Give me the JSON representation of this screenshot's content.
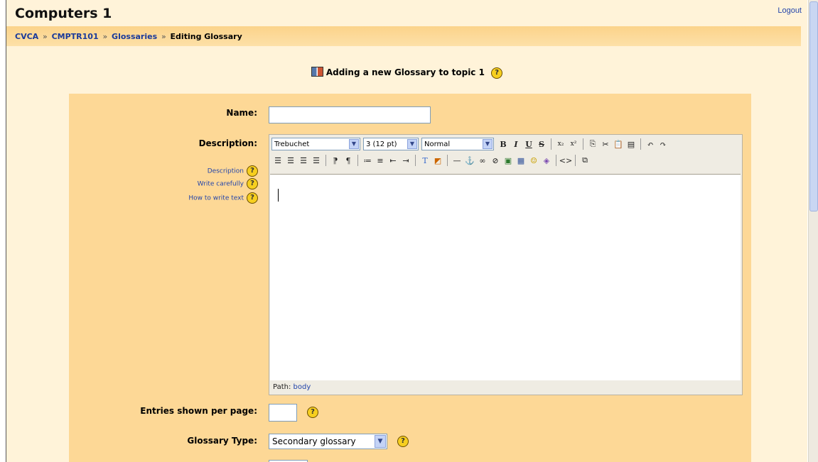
{
  "header": {
    "site_title": "Computers 1",
    "logout_label": "Logout"
  },
  "breadcrumb": {
    "items": [
      "CVCA",
      "CMPTR101",
      "Glossaries"
    ],
    "current": "Editing Glossary",
    "separator": "»"
  },
  "page": {
    "heading": "Adding a new Glossary to topic 1"
  },
  "form": {
    "name_label": "Name:",
    "name_value": "",
    "description_label": "Description:",
    "help_links": [
      "Description",
      "Write carefully",
      "How to write text"
    ],
    "entries_label": "Entries shown per page:",
    "entries_value": "",
    "glossary_type_label": "Glossary Type:",
    "glossary_type_value": "Secondary glossary"
  },
  "editor": {
    "font_family": "Trebuchet",
    "font_size": "3 (12 pt)",
    "format": "Normal",
    "path_label": "Path:",
    "path_value": "body"
  },
  "icons": {
    "help": "?",
    "dropdown": "▼"
  },
  "colors": {
    "page_bg": "#fff3d9",
    "navbar": "#fbd38a",
    "form_bg": "#fdd896",
    "link": "#1a3a9a"
  }
}
